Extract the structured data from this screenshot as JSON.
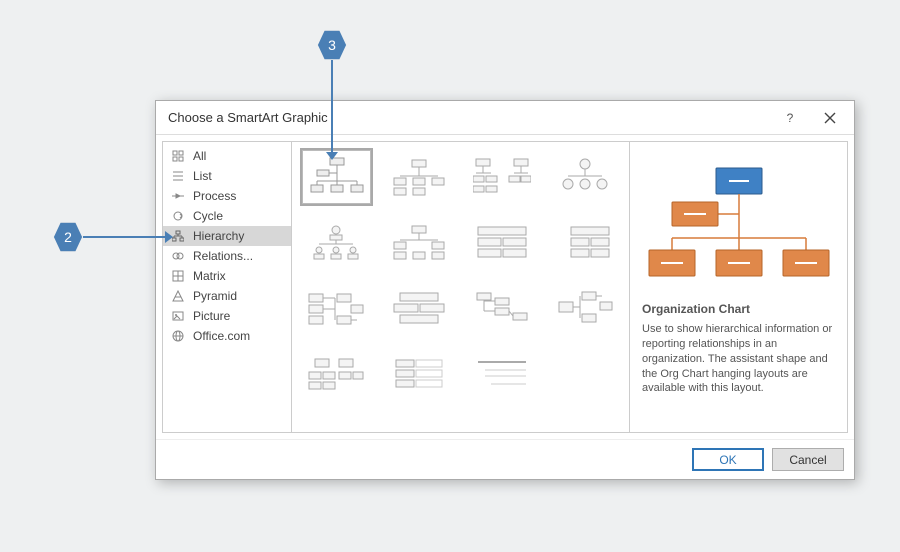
{
  "dialog": {
    "title": "Choose a SmartArt Graphic"
  },
  "sidebar": {
    "items": [
      {
        "icon": "all",
        "label": "All"
      },
      {
        "icon": "list",
        "label": "List"
      },
      {
        "icon": "process",
        "label": "Process"
      },
      {
        "icon": "cycle",
        "label": "Cycle"
      },
      {
        "icon": "hierarchy",
        "label": "Hierarchy",
        "selected": true
      },
      {
        "icon": "relationship",
        "label": "Relations..."
      },
      {
        "icon": "matrix",
        "label": "Matrix"
      },
      {
        "icon": "pyramid",
        "label": "Pyramid"
      },
      {
        "icon": "picture",
        "label": "Picture"
      },
      {
        "icon": "office",
        "label": "Office.com"
      }
    ]
  },
  "gallery": {
    "selected_index": 0,
    "count": 15
  },
  "preview": {
    "title": "Organization Chart",
    "description": "Use to show hierarchical information or reporting relationships in an organization. The assistant shape and the Org Chart hanging layouts are available with this layout."
  },
  "buttons": {
    "ok": "OK",
    "cancel": "Cancel"
  },
  "callouts": {
    "c2": "2",
    "c3": "3"
  }
}
